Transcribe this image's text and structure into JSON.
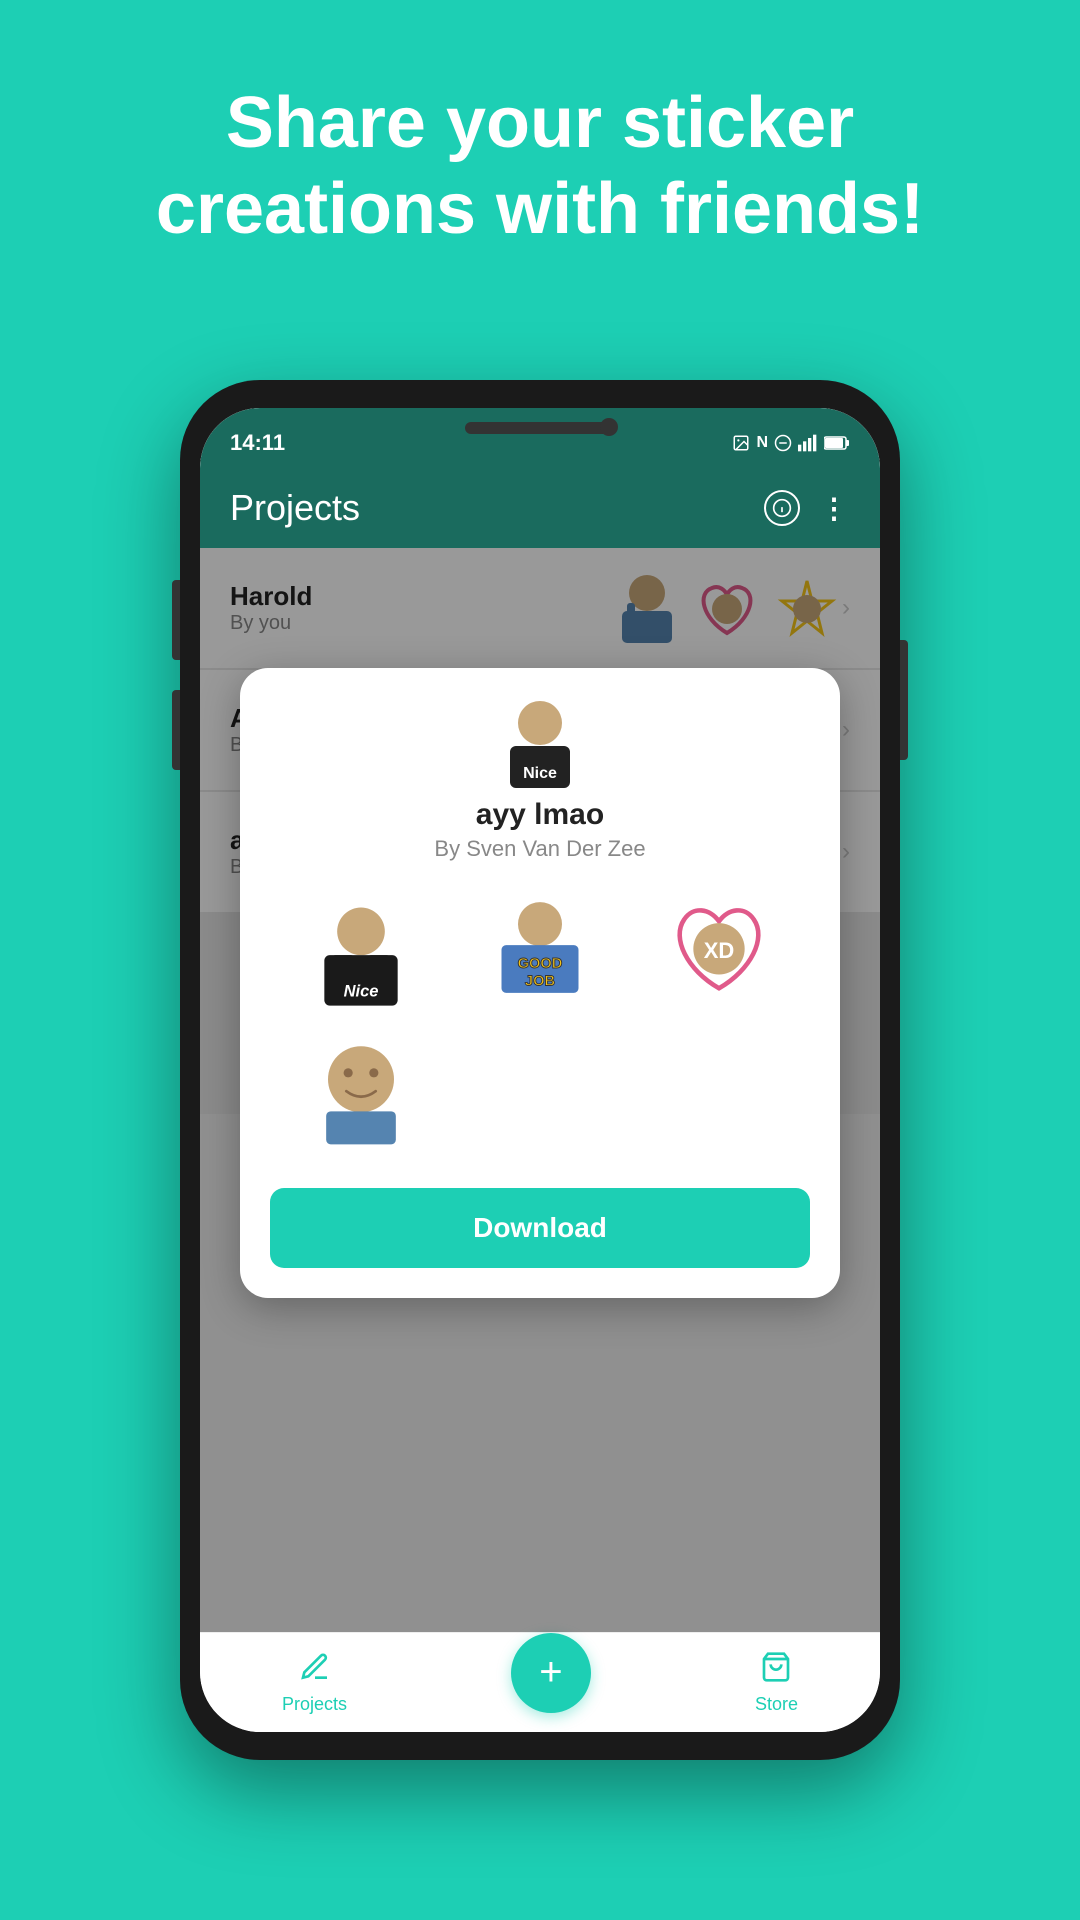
{
  "background_color": "#1DCFB4",
  "header": {
    "title": "Share your sticker\ncreations with friends!"
  },
  "phone": {
    "status_bar": {
      "time": "14:11",
      "icons": "NFC signal battery"
    },
    "top_bar": {
      "title": "Projects"
    },
    "projects": [
      {
        "name": "Harold",
        "by": "By you"
      },
      {
        "name": "Aliens",
        "by": "By you"
      },
      {
        "name": "ayy lmao",
        "by": "By you"
      }
    ],
    "modal": {
      "sticker_pack_name": "ayy lmao",
      "sticker_pack_by": "By Sven Van Der Zee",
      "download_button_label": "Download"
    },
    "bottom_nav": {
      "projects_label": "Projects",
      "store_label": "Store",
      "fab_icon": "+"
    }
  }
}
